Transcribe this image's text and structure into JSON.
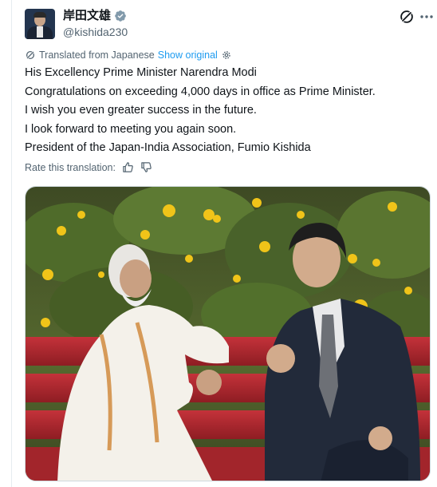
{
  "author": {
    "display_name": "岸田文雄",
    "handle": "@kishida230",
    "verified_color": "#829aab"
  },
  "translation": {
    "label": "Translated from Japanese",
    "show_original": "Show original"
  },
  "tweet": {
    "lines": [
      "His Excellency Prime Minister Narendra Modi",
      "Congratulations on exceeding 4,000 days in office as Prime Minister.",
      "I wish you even greater success in the future.",
      "I look forward to meeting you again soon.",
      "President of the Japan-India Association, Fumio Kishida"
    ]
  },
  "rate": {
    "label": "Rate this translation:"
  },
  "icons": {
    "grok": "grok-icon",
    "more": "more-icon",
    "translate": "translate-icon",
    "settings": "gear-icon",
    "thumbs_up": "thumbs-up-icon",
    "thumbs_down": "thumbs-down-icon"
  },
  "colors": {
    "text": "#0f1419",
    "secondary": "#536471",
    "link": "#1d9bf0",
    "bench_red": "#b3262c"
  }
}
